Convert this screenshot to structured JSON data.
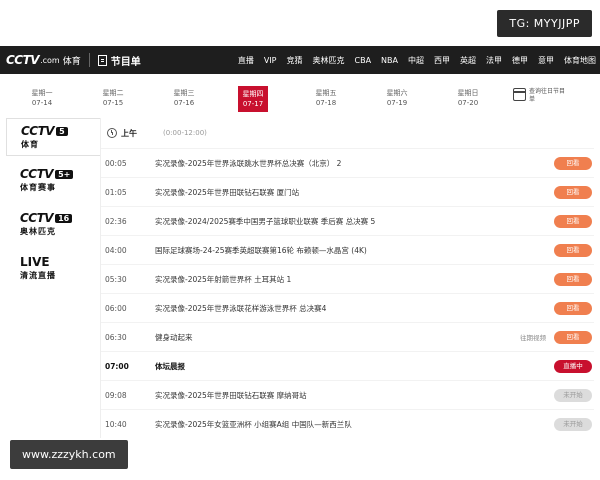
{
  "watermarks": {
    "top": "TG: MYYJJPP",
    "bottom": "www.zzzykh.com"
  },
  "header": {
    "logo_main": "CCTV",
    "logo_com": ".com",
    "logo_cn": "体育",
    "guide_label": "节目单",
    "nav": [
      "直播",
      "VIP",
      "竞猜",
      "奥林匹克",
      "CBA",
      "NBA",
      "中超",
      "西甲",
      "英超",
      "法甲",
      "德甲",
      "意甲",
      "体育地图"
    ]
  },
  "dates": [
    {
      "weekday": "星期一",
      "date": "07-14",
      "active": false
    },
    {
      "weekday": "星期二",
      "date": "07-15",
      "active": false
    },
    {
      "weekday": "星期三",
      "date": "07-16",
      "active": false
    },
    {
      "weekday": "星期四",
      "date": "07-17",
      "active": true
    },
    {
      "weekday": "星期五",
      "date": "07-18",
      "active": false
    },
    {
      "weekday": "星期六",
      "date": "07-19",
      "active": false
    },
    {
      "weekday": "星期日",
      "date": "07-20",
      "active": false
    }
  ],
  "calendar_label": "查询往日节目单",
  "channels": [
    {
      "logo": "CCTV",
      "num": "5",
      "sub": "体育",
      "active": true
    },
    {
      "logo": "CCTV",
      "num": "5+",
      "sub": "体育赛事",
      "active": false
    },
    {
      "logo": "CCTV",
      "num": "16",
      "sub": "奥林匹克",
      "active": false
    },
    {
      "logo": "LIVE",
      "num": "",
      "sub": "清流直播",
      "active": false
    }
  ],
  "period": {
    "label": "上午",
    "range": "(0:00-12:00)"
  },
  "programs": [
    {
      "time": "00:05",
      "title": "实况录像-2025年世界泳联跳水世界杯总决赛（北京） 2",
      "note": "",
      "status": "回看",
      "kind": "replay"
    },
    {
      "time": "01:05",
      "title": "实况录像-2025年世界田联钻石联赛 厦门站",
      "note": "",
      "status": "回看",
      "kind": "replay"
    },
    {
      "time": "02:36",
      "title": "实况录像-2024/2025赛季中国男子篮球职业联赛 季后赛 总决赛 5",
      "note": "",
      "status": "回看",
      "kind": "replay"
    },
    {
      "time": "04:00",
      "title": "国际足球赛场-24-25赛季英超联赛第16轮 布赖顿—水晶宫 (4K)",
      "note": "",
      "status": "回看",
      "kind": "replay"
    },
    {
      "time": "05:30",
      "title": "实况录像-2025年射箭世界杯 土耳其站 1",
      "note": "",
      "status": "回看",
      "kind": "replay"
    },
    {
      "time": "06:00",
      "title": "实况录像-2025年世界泳联花样游泳世界杯 总决赛4",
      "note": "",
      "status": "回看",
      "kind": "replay"
    },
    {
      "time": "06:30",
      "title": "健身动起来",
      "note": "往期视频",
      "status": "回看",
      "kind": "replay"
    },
    {
      "time": "07:00",
      "title": "体坛晨报",
      "note": "",
      "status": "直播中",
      "kind": "live"
    },
    {
      "time": "09:08",
      "title": "实况录像-2025年世界田联钻石联赛 摩纳哥站",
      "note": "",
      "status": "未开始",
      "kind": "soon"
    },
    {
      "time": "10:40",
      "title": "实况录像-2025年女篮亚洲杯 小组赛A组 中国队—新西兰队",
      "note": "",
      "status": "未开始",
      "kind": "soon"
    }
  ]
}
